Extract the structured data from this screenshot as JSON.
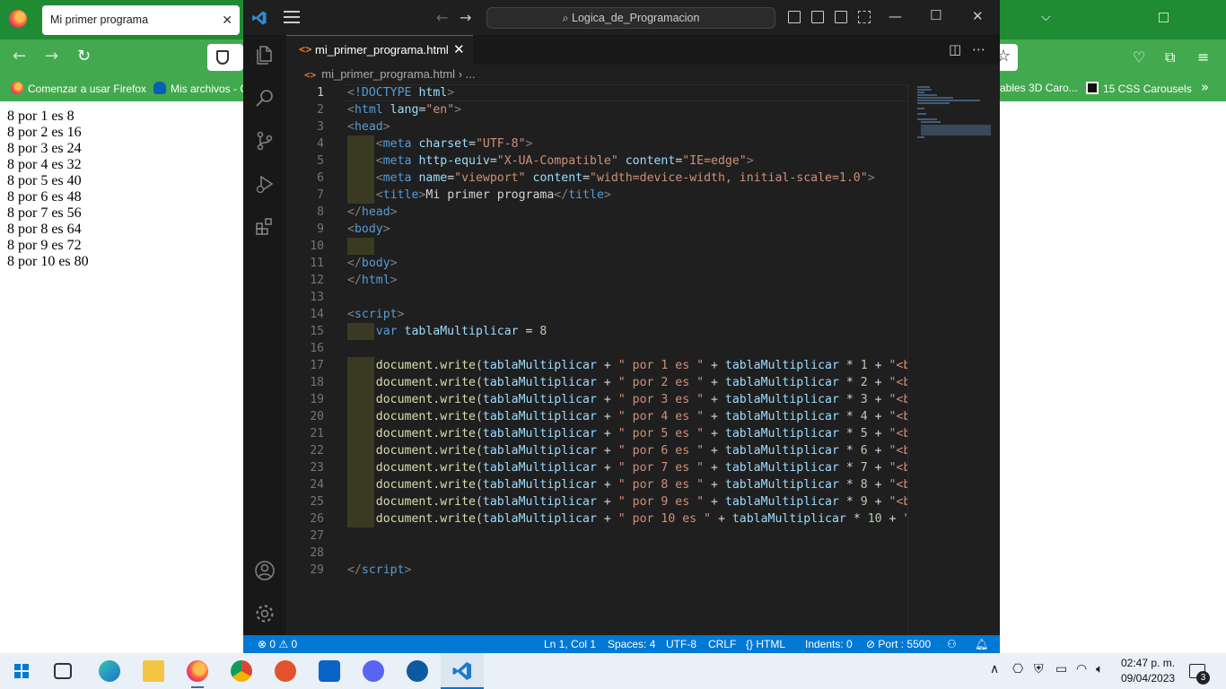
{
  "firefox": {
    "tab_title": "Mi primer programa",
    "bookmarks": [
      {
        "label": "Comenzar a usar Firefox"
      },
      {
        "label": "Mis archivos - C"
      },
      {
        "label": "ables 3D Caro..."
      },
      {
        "label": "15 CSS Carousels"
      }
    ],
    "output_lines": [
      "8 por 1 es 8",
      "8 por 2 es 16",
      "8 por 3 es 24",
      "8 por 4 es 32",
      "8 por 5 es 40",
      "8 por 6 es 48",
      "8 por 7 es 56",
      "8 por 8 es 64",
      "8 por 9 es 72",
      "8 por 10 es 80"
    ]
  },
  "vscode": {
    "search_text": "Logica_de_Programacion",
    "tab_label": "mi_primer_programa.html",
    "breadcrumb": "mi_primer_programa.html",
    "breadcrumb_more": "...",
    "line_numbers": [
      "1",
      "2",
      "3",
      "4",
      "5",
      "6",
      "7",
      "8",
      "9",
      "10",
      "11",
      "12",
      "13",
      "14",
      "15",
      "16",
      "17",
      "18",
      "19",
      "20",
      "21",
      "22",
      "23",
      "24",
      "25",
      "26",
      "27",
      "28",
      "29"
    ],
    "status": {
      "problems_errors": "0",
      "problems_warnings": "0",
      "position": "Ln 1, Col 1",
      "spaces": "Spaces: 4",
      "encoding": "UTF-8",
      "eol": "CRLF",
      "language": "HTML",
      "indents": "Indents: 0",
      "port": "Port : 5500"
    }
  },
  "taskbar": {
    "time": "02:47 p. m.",
    "date": "09/04/2023",
    "notification_count": "3"
  }
}
